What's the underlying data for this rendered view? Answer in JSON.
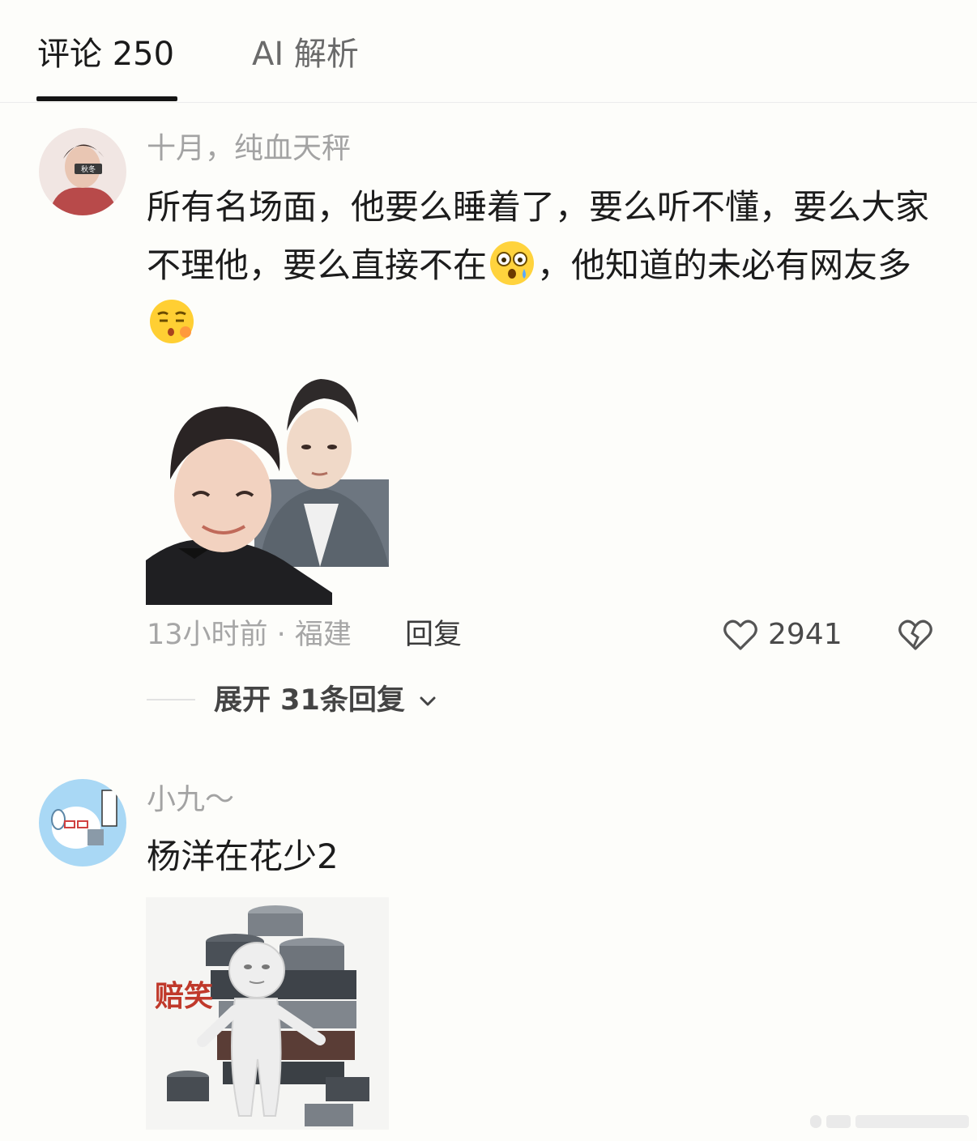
{
  "tabs": {
    "comments_label": "评论 250",
    "ai_label": "AI 解析"
  },
  "comment1": {
    "username": "十月，纯血天秤",
    "text_part1": "所有名场面，他要么睡着了，要么听不懂，要么大家不理他，要么直接不在",
    "text_part2": "，他知道的未必有网友多",
    "emoji1": "shocked-face-emoji",
    "emoji2": "kissing-face-emoji",
    "time_location": "13小时前 · 福建",
    "reply_label": "回复",
    "like_count": "2941",
    "expand_label": "展开 31条回复"
  },
  "comment2": {
    "username": "小九～",
    "text": "杨洋在花少2",
    "sticker_caption": "赔笑"
  },
  "colors": {
    "background": "#fdfdfa",
    "username": "#a3a3a3",
    "text": "#1c1c1c",
    "tab_active": "#141414"
  }
}
